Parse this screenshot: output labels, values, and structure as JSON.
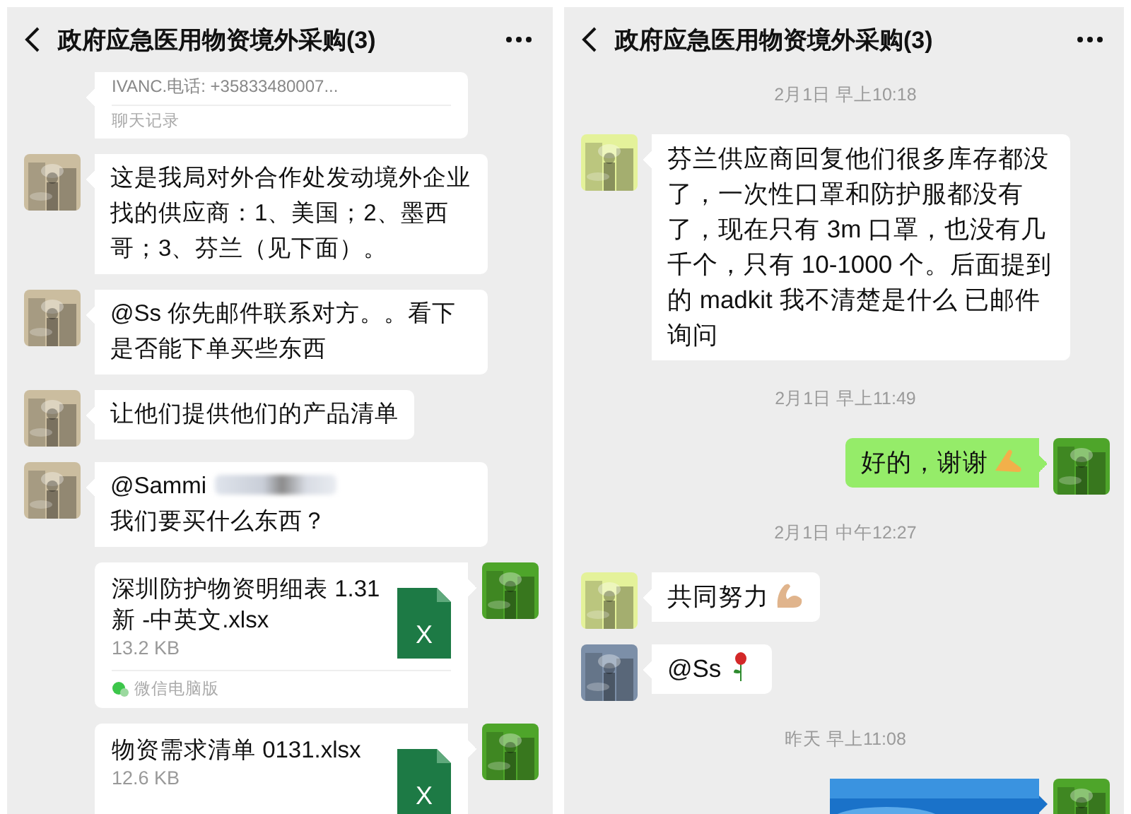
{
  "panels": [
    {
      "title": "政府应急医用物资境外采购(3)",
      "messages": [
        {
          "kind": "record",
          "outgoing": false,
          "text": "IVANC.电话: +35833480007...",
          "footer": "聊天记录"
        },
        {
          "kind": "text",
          "outgoing": false,
          "avatar": {
            "kind": "picture",
            "color": "#cbbd9f"
          },
          "parts": [
            {
              "kind": "text",
              "text": "这是我局对外合作处发动境外企业找的供应商：1、美国；2、墨西哥；3、芬兰（见下面）。"
            }
          ]
        },
        {
          "kind": "text",
          "outgoing": false,
          "avatar": {
            "kind": "picture",
            "color": "#cbbd9f"
          },
          "parts": [
            {
              "kind": "text",
              "text": "@Ss 你先邮件联系对方。。看下是否能下单买些东西"
            }
          ]
        },
        {
          "kind": "text",
          "outgoing": false,
          "avatar": {
            "kind": "picture",
            "color": "#cbbd9f"
          },
          "parts": [
            {
              "kind": "text",
              "text": "让他们提供他们的产品清单"
            }
          ]
        },
        {
          "kind": "text",
          "outgoing": false,
          "avatar": {
            "kind": "picture",
            "color": "#cbbd9f"
          },
          "parts": [
            {
              "kind": "text",
              "text": "@Sammi"
            },
            {
              "kind": "redacted"
            },
            {
              "kind": "text",
              "text": "我们要买什么东西？"
            }
          ]
        },
        {
          "kind": "file",
          "outgoing": true,
          "avatar": {
            "kind": "picture",
            "color": "#4ea52a"
          },
          "name": "深圳防护物资明细表 1.31 新 -中英文.xlsx",
          "size": "13.2 KB",
          "icon_letter": "X",
          "source": "微信电脑版"
        },
        {
          "kind": "file",
          "outgoing": true,
          "avatar": {
            "kind": "picture",
            "color": "#4ea52a"
          },
          "name": "物资需求清单 0131.xlsx",
          "size": "12.6 KB",
          "icon_letter": "X"
        }
      ]
    },
    {
      "title": "政府应急医用物资境外采购(3)",
      "messages": [
        {
          "kind": "time",
          "text": "2月1日 早上10:18"
        },
        {
          "kind": "text",
          "outgoing": false,
          "avatar": {
            "kind": "picture",
            "color": "#e4f29a"
          },
          "parts": [
            {
              "kind": "text",
              "text": "芬兰供应商回复他们很多库存都没了，一次性口罩和防护服都没有了，现在只有 3m 口罩，也没有几千个，只有 10-1000 个。后面提到的 madkit 我不清楚是什么 已邮件询问"
            }
          ]
        },
        {
          "kind": "time",
          "text": "2月1日 早上11:49"
        },
        {
          "kind": "text",
          "outgoing": true,
          "avatar": {
            "kind": "picture",
            "color": "#4ea52a"
          },
          "parts": [
            {
              "kind": "text",
              "text": "好的，谢谢"
            },
            {
              "kind": "pinch"
            }
          ]
        },
        {
          "kind": "time",
          "text": "2月1日 中午12:27"
        },
        {
          "kind": "text",
          "outgoing": false,
          "avatar": {
            "kind": "picture",
            "color": "#e4f29a"
          },
          "parts": [
            {
              "kind": "text",
              "text": "共同努力"
            },
            {
              "kind": "flex"
            }
          ]
        },
        {
          "kind": "text",
          "outgoing": false,
          "avatar": {
            "kind": "picture",
            "color": "#7c8fa8"
          },
          "parts": [
            {
              "kind": "text",
              "text": "@Ss"
            },
            {
              "kind": "rose"
            }
          ]
        },
        {
          "kind": "time",
          "text": "昨天 早上11:08"
        },
        {
          "outgoing": true,
          "avatar": {
            "kind": "picture",
            "color": "#4ea52a"
          }
        }
      ]
    }
  ]
}
